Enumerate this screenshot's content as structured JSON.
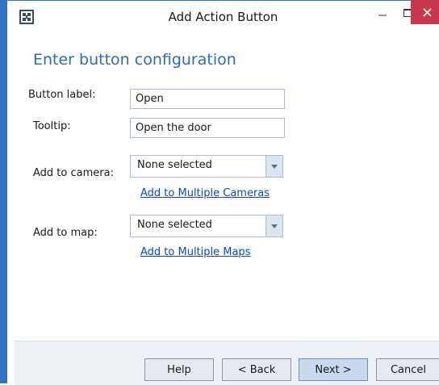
{
  "window": {
    "title": "Add Action Button",
    "accent_color": "#2f75c0",
    "close_color": "#c7384f"
  },
  "heading": "Enter button configuration",
  "form": {
    "button_label": {
      "label": "Button label:",
      "value": "Open"
    },
    "tooltip": {
      "label": "Tooltip:",
      "value": "Open the door"
    },
    "camera": {
      "label": "Add to camera:",
      "selected": "None selected",
      "link": "Add to Multiple Cameras"
    },
    "map": {
      "label": "Add to map:",
      "selected": "None selected",
      "link": "Add to Multiple Maps"
    }
  },
  "footer": {
    "help": "Help",
    "back": "< Back",
    "next": "Next >",
    "cancel": "Cancel"
  }
}
